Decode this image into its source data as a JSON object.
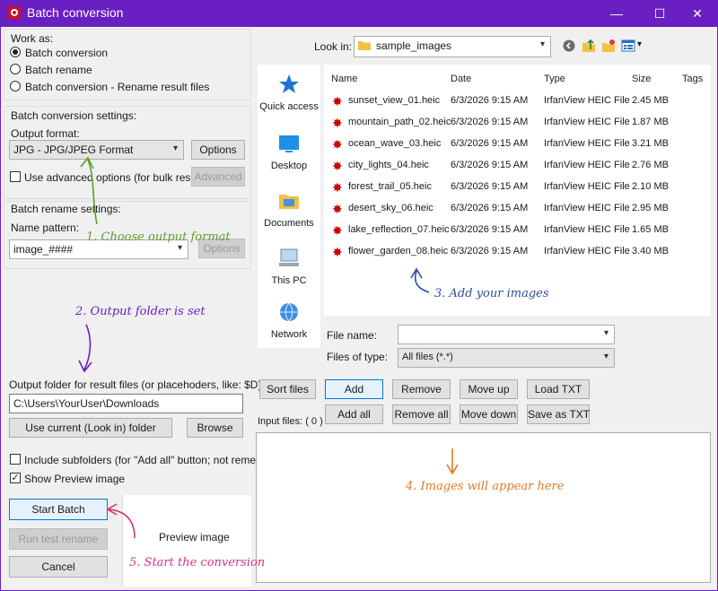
{
  "window": {
    "title": "Batch conversion",
    "minimize": "—",
    "maximize": "☐",
    "close": "✕"
  },
  "work_as": {
    "label": "Work as:",
    "options": [
      "Batch conversion",
      "Batch rename",
      "Batch conversion - Rename result files"
    ],
    "selected": 0
  },
  "conv_settings": {
    "label": "Batch conversion settings:",
    "output_format_label": "Output format:",
    "output_format_value": "JPG - JPG/JPEG Format",
    "options_button": "Options",
    "advanced_checkbox": "Use advanced options (for bulk resize...)",
    "advanced_button": "Advanced"
  },
  "rename_settings": {
    "label": "Batch rename settings:",
    "name_pattern_label": "Name pattern:",
    "name_pattern_value": "image_####",
    "options_button": "Options"
  },
  "output": {
    "label": "Output folder for result files (or placehoders, like: $D)",
    "folder_value": "C:\\Users\\YourUser\\Downloads",
    "use_current_button": "Use current (Look in) folder",
    "browse_button": "Browse"
  },
  "flags": {
    "include_subfolders": "Include subfolders (for \"Add all\" button; not remembered)",
    "show_preview": "Show Preview image"
  },
  "actions": {
    "start_batch": "Start Batch",
    "run_test_rename": "Run test rename",
    "cancel": "Cancel",
    "preview_image": "Preview image"
  },
  "browser": {
    "look_in_label": "Look in:",
    "look_in_value": "sample_images",
    "places": [
      "Quick access",
      "Desktop",
      "Documents",
      "This PC",
      "Network"
    ],
    "columns": [
      "Name",
      "Date",
      "Type",
      "Size",
      "Tags"
    ],
    "files": [
      {
        "name": "sunset_view_01.heic",
        "date": "6/3/2026 9:15 AM",
        "type": "IrfanView HEIC File",
        "size": "2.45 MB"
      },
      {
        "name": "mountain_path_02.heic",
        "date": "6/3/2026 9:15 AM",
        "type": "IrfanView HEIC File",
        "size": "1.87 MB"
      },
      {
        "name": "ocean_wave_03.heic",
        "date": "6/3/2026 9:15 AM",
        "type": "IrfanView HEIC File",
        "size": "3.21 MB"
      },
      {
        "name": "city_lights_04.heic",
        "date": "6/3/2026 9:15 AM",
        "type": "IrfanView HEIC File",
        "size": "2.76 MB"
      },
      {
        "name": "forest_trail_05.heic",
        "date": "6/3/2026 9:15 AM",
        "type": "IrfanView HEIC File",
        "size": "2.10 MB"
      },
      {
        "name": "desert_sky_06.heic",
        "date": "6/3/2026 9:15 AM",
        "type": "IrfanView HEIC File",
        "size": "2.95 MB"
      },
      {
        "name": "lake_reflection_07.heic",
        "date": "6/3/2026 9:15 AM",
        "type": "IrfanView HEIC File",
        "size": "1.65 MB"
      },
      {
        "name": "flower_garden_08.heic",
        "date": "6/3/2026 9:15 AM",
        "type": "IrfanView HEIC File",
        "size": "3.40 MB"
      }
    ],
    "file_name_label": "File name:",
    "file_name_value": "",
    "files_of_type_label": "Files of type:",
    "files_of_type_value": "All files (*.*)"
  },
  "list_buttons": {
    "sort_files": "Sort files",
    "add": "Add",
    "remove": "Remove",
    "move_up": "Move up",
    "load_txt": "Load TXT",
    "add_all": "Add all",
    "remove_all": "Remove all",
    "move_down": "Move down",
    "save_as_txt": "Save as TXT"
  },
  "input_files_label": "Input files: ( 0 )",
  "annotations": {
    "step1": "1. Choose output format",
    "step2": "2. Output folder is set",
    "step3": "3. Add your images",
    "step4": "4. Images will appear here",
    "step5": "5. Start the conversion"
  },
  "colors": {
    "titlebar": "#6a1fc2",
    "step1": "#5aa02c",
    "step2": "#6a1fc2",
    "step3": "#2a4e9e",
    "step4": "#e07a1f",
    "step5": "#d6337a"
  }
}
